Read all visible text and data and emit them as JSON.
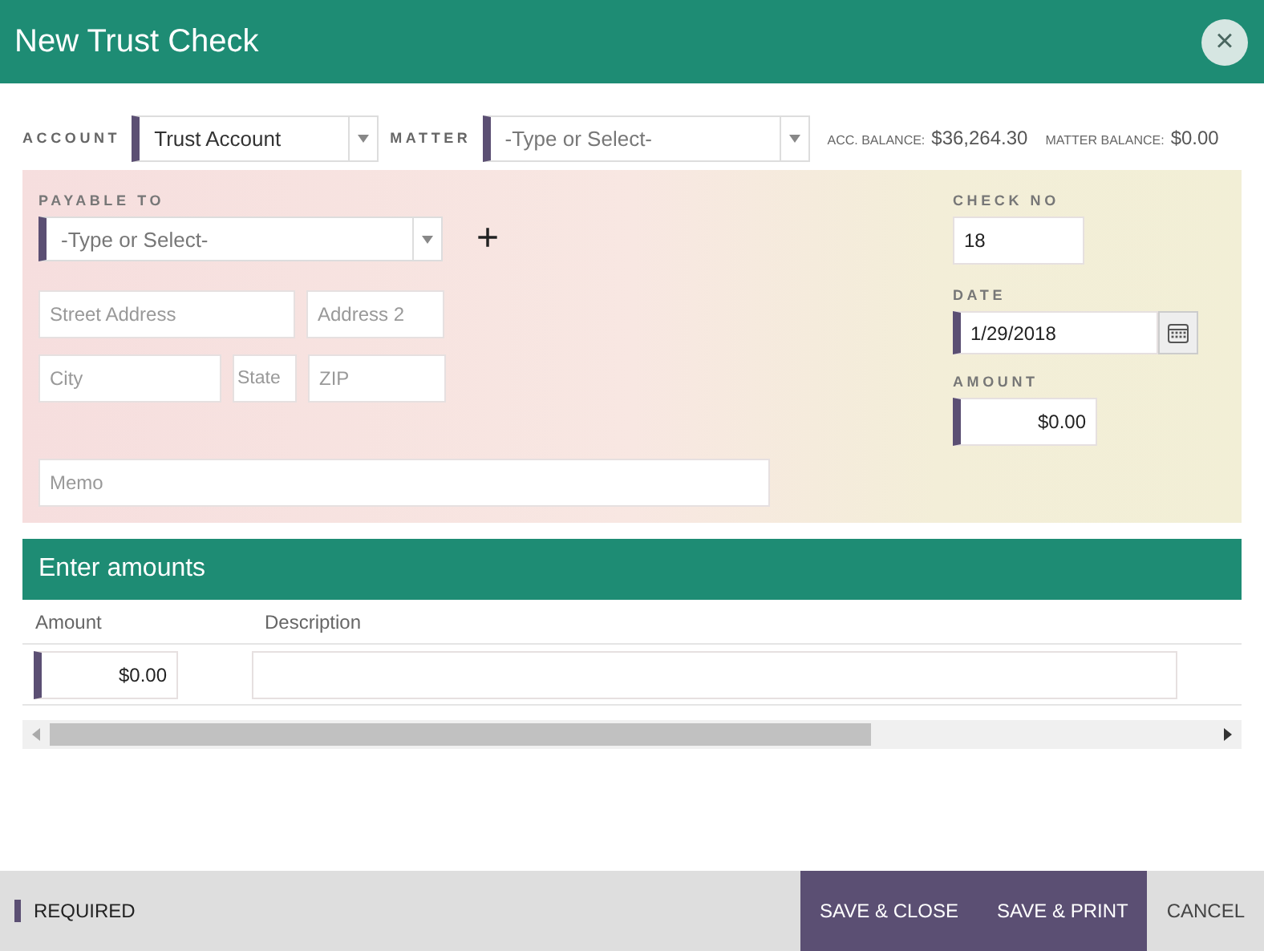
{
  "window": {
    "title": "New Trust Check",
    "close": "×"
  },
  "account": {
    "label": "ACCOUNT",
    "value": "Trust Account",
    "required": true
  },
  "matter": {
    "label": "MATTER",
    "placeholder": "-Type or Select-",
    "required": true
  },
  "balances": [
    {
      "label": "ACC. BALANCE:",
      "value": "$36,264.30"
    },
    {
      "label": "MATTER BALANCE:",
      "value": "$0.00"
    }
  ],
  "check": {
    "payable_to": {
      "label": "PAYABLE TO",
      "placeholder": "-Type or Select-",
      "required": true,
      "add": "+"
    },
    "address_rows": [
      [
        {
          "placeholder": "Street Address",
          "kind": "street"
        },
        {
          "placeholder": "Address 2",
          "kind": "short"
        }
      ],
      [
        {
          "placeholder": "City",
          "kind": "city"
        },
        {
          "placeholder": "State",
          "kind": "state"
        },
        {
          "placeholder": "ZIP",
          "kind": "short"
        }
      ]
    ],
    "memo": {
      "placeholder": "Memo"
    },
    "check_no": {
      "label": "CHECK NO",
      "value": "18",
      "required": false
    },
    "date": {
      "label": "DATE",
      "value": "1/29/2018",
      "required": true
    },
    "amount": {
      "label": "AMOUNT",
      "value": "$0.00",
      "required": true
    }
  },
  "amounts": {
    "title": "Enter amounts",
    "columns": [
      "Amount",
      "Description"
    ],
    "rows": [
      {
        "amount": "$0.00"
      }
    ]
  },
  "footer": {
    "required_label": "REQUIRED",
    "buttons": [
      {
        "label": "SAVE & CLOSE",
        "kind": "primary"
      },
      {
        "label": "SAVE & PRINT",
        "kind": "primary"
      },
      {
        "label": "CANCEL",
        "kind": "plain"
      }
    ]
  }
}
